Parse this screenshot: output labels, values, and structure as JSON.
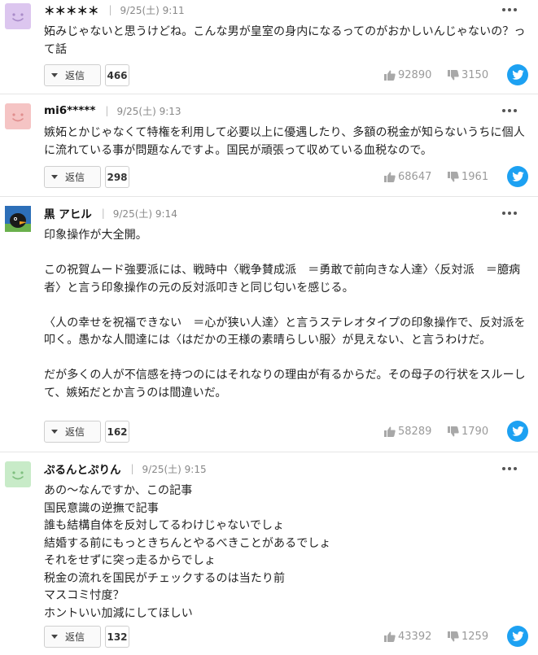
{
  "comments": [
    {
      "username": "＊＊＊＊＊",
      "time": "9/25(土) 9:11",
      "avatar_color": "#dcc6ef",
      "body": "妬みじゃないと思うけどね。こんな男が皇室の身内になるってのがおかしいんじゃないの？って話",
      "reply_label": "返信",
      "reply_count": "466",
      "likes": "92890",
      "dislikes": "3150"
    },
    {
      "username": "mi6*****",
      "time": "9/25(土) 9:13",
      "avatar_color": "#f5c4c4",
      "body": "嫉妬とかじゃなくて特権を利用して必要以上に優遇したり、多額の税金が知らないうちに個人に流れている事が問題なんですよ。国民が頑張って収めている血税なので。",
      "reply_label": "返信",
      "reply_count": "298",
      "likes": "68647",
      "dislikes": "1961"
    },
    {
      "username": "黒 アヒル",
      "time": "9/25(土) 9:14",
      "avatar_color": "#1f5fa8",
      "body": "印象操作が大全開。\n\nこの祝賀ムード強要派には、戦時中〈戦争賛成派　＝勇敢で前向きな人達〉〈反対派　＝臆病者〉と言う印象操作の元の反対派叩きと同じ匂いを感じる。\n\n〈人の幸せを祝福できない　＝心が狭い人達〉と言うステレオタイプの印象操作で、反対派を叩く。愚かな人間達には〈はだかの王様の素晴らしい服〉が見えない、と言うわけだ。\n\nだが多くの人が不信感を持つのにはそれなりの理由が有るからだ。その母子の行状をスルーして、嫉妬だとか言うのは間違いだ。",
      "reply_label": "返信",
      "reply_count": "162",
      "likes": "58289",
      "dislikes": "1790"
    },
    {
      "username": "ぷるんとぷりん",
      "time": "9/25(土) 9:15",
      "avatar_color": "#c8ebc8",
      "body": "あの～なんですか、この記事\n国民意識の逆撫で記事\n誰も結構自体を反対してるわけじゃないでしょ\n結婚する前にもっときちんとやるべきことがあるでしょ\nそれをせずに突っ走るからでしょ\n税金の流れを国民がチェックするのは当たり前\nマスコミ忖度？\nホントいい加減にしてほしい",
      "reply_label": "返信",
      "reply_count": "132",
      "likes": "43392",
      "dislikes": "1259"
    }
  ],
  "icons": {
    "more": "more-options-icon",
    "like": "thumbs-up-icon",
    "dislike": "thumbs-down-icon",
    "share": "twitter-icon",
    "reply": "reply-triangle-icon"
  },
  "colors": {
    "twitter": "#1da1f2",
    "meta_text": "#888888",
    "vote_text": "#9a9a9a"
  }
}
